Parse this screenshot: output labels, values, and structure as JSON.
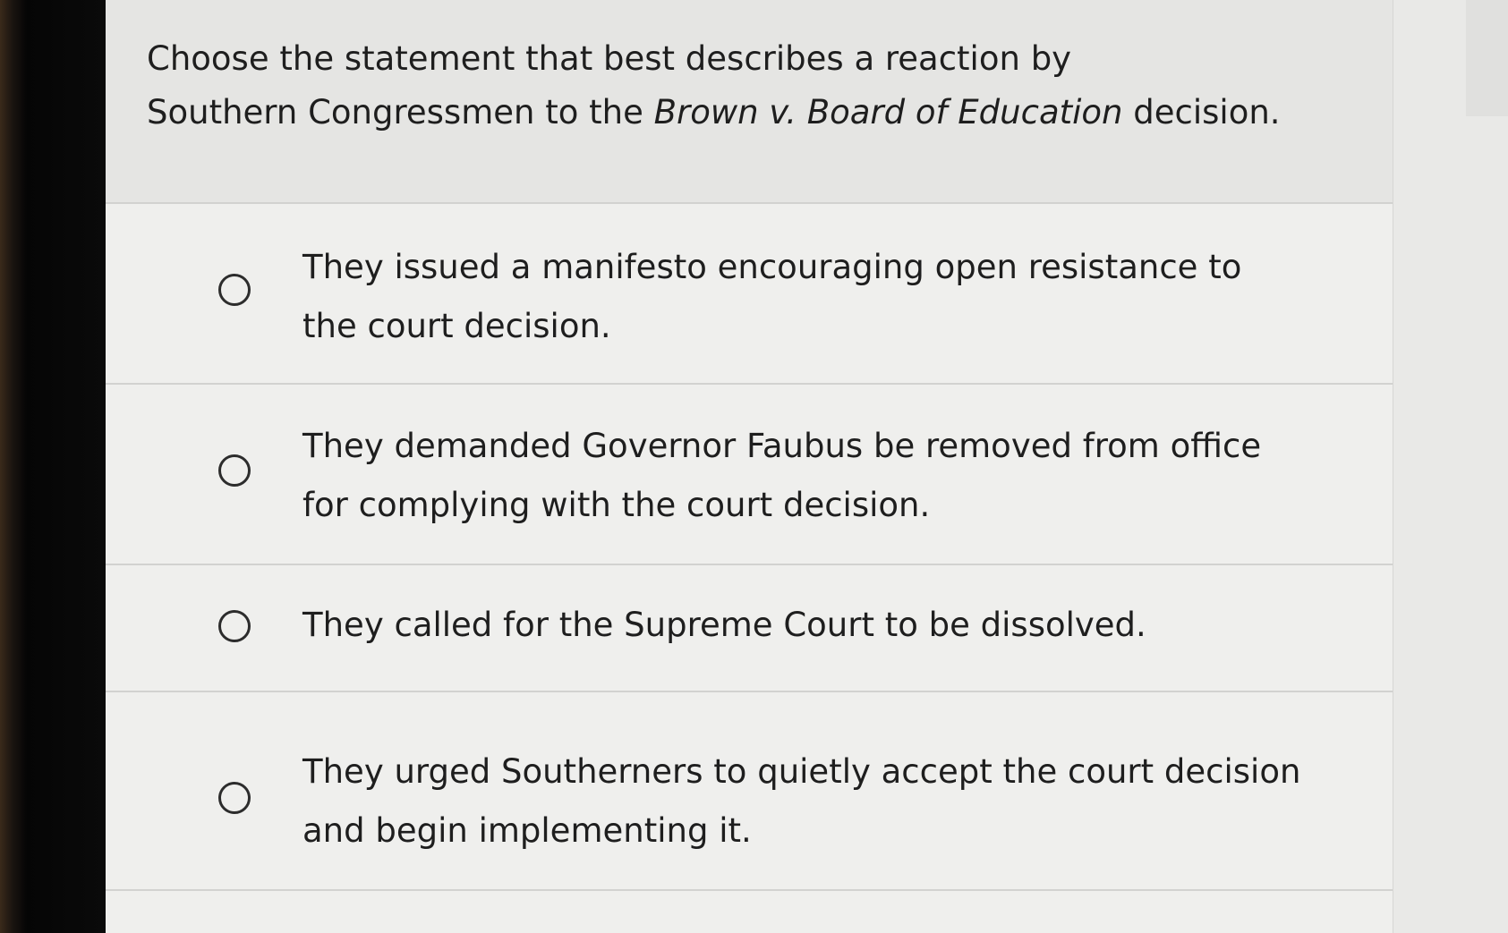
{
  "question": {
    "text_before": "Choose the statement that best describes a reaction by",
    "text_line2_start": "Southern Congressmen to the ",
    "case_name": "Brown v. Board of Education",
    "text_end": " decision."
  },
  "options": [
    {
      "label": "They issued a manifesto encouraging open resistance to the court decision.",
      "selected": false
    },
    {
      "label": "They demanded Governor Faubus be removed from office for complying with the court decision.",
      "selected": false
    },
    {
      "label": "They called for the Supreme Court to be dissolved.",
      "selected": false
    },
    {
      "label": "They urged Southerners to quietly accept the court decision and begin implementing it.",
      "selected": false
    }
  ]
}
